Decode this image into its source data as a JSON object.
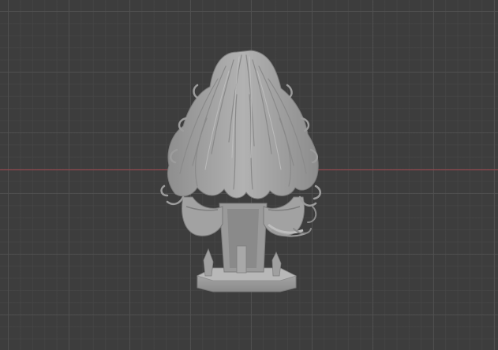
{
  "viewport": {
    "background_color": "#3d3d3d",
    "grid_color": "#4e4e4e",
    "x_axis_color": "#a0464e"
  },
  "model": {
    "object": "figure-bust-back-view",
    "surface_color": "#a4a4a4",
    "shadow_color": "#7a7a7a"
  }
}
